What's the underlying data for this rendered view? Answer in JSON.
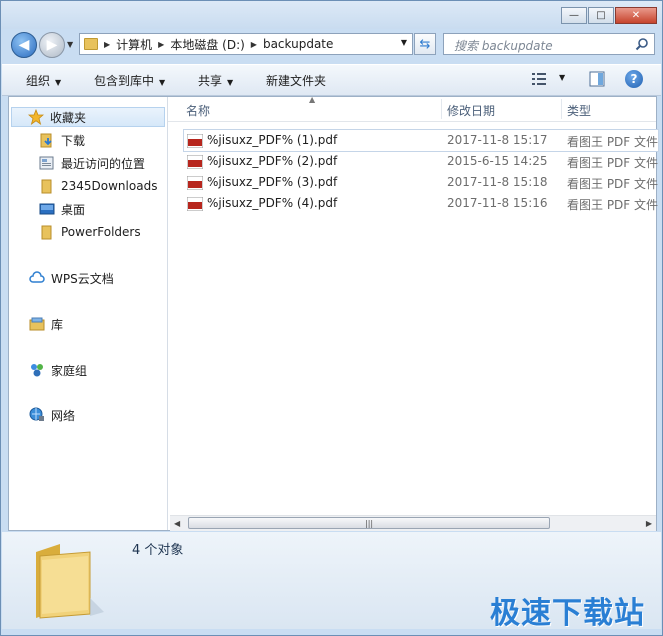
{
  "window": {
    "controls": {
      "minimize": "—",
      "maximize": "□",
      "close": "✕"
    }
  },
  "address": {
    "crumbs": [
      "计算机",
      "本地磁盘 (D:)",
      "backupdate"
    ]
  },
  "search": {
    "placeholder": "搜索 backupdate"
  },
  "toolbar": {
    "organize": "组织",
    "include_in_library": "包含到库中",
    "share": "共享",
    "new_folder": "新建文件夹"
  },
  "nav": {
    "favorites": "收藏夹",
    "downloads": "下载",
    "recent": "最近访问的位置",
    "downloads2345": "2345Downloads",
    "desktop": "桌面",
    "powerfolders": "PowerFolders",
    "wps": "WPS云文档",
    "libraries": "库",
    "homegroup": "家庭组",
    "network": "网络"
  },
  "columns": {
    "name": "名称",
    "modified": "修改日期",
    "type": "类型"
  },
  "files": [
    {
      "name": "%jisuxz_PDF% (1).pdf",
      "modified": "2017-11-8 15:17",
      "type": "看图王 PDF 文件"
    },
    {
      "name": "%jisuxz_PDF% (2).pdf",
      "modified": "2015-6-15 14:25",
      "type": "看图王 PDF 文件"
    },
    {
      "name": "%jisuxz_PDF% (3).pdf",
      "modified": "2017-11-8 15:18",
      "type": "看图王 PDF 文件"
    },
    {
      "name": "%jisuxz_PDF% (4).pdf",
      "modified": "2017-11-8 15:16",
      "type": "看图王 PDF 文件"
    }
  ],
  "status": {
    "count": "4 个对象"
  },
  "watermark": "极速下载站",
  "colors": {
    "accent": "#2a7fd4",
    "pdf_icon": "#b7261d",
    "folder": "#e8c25c"
  }
}
